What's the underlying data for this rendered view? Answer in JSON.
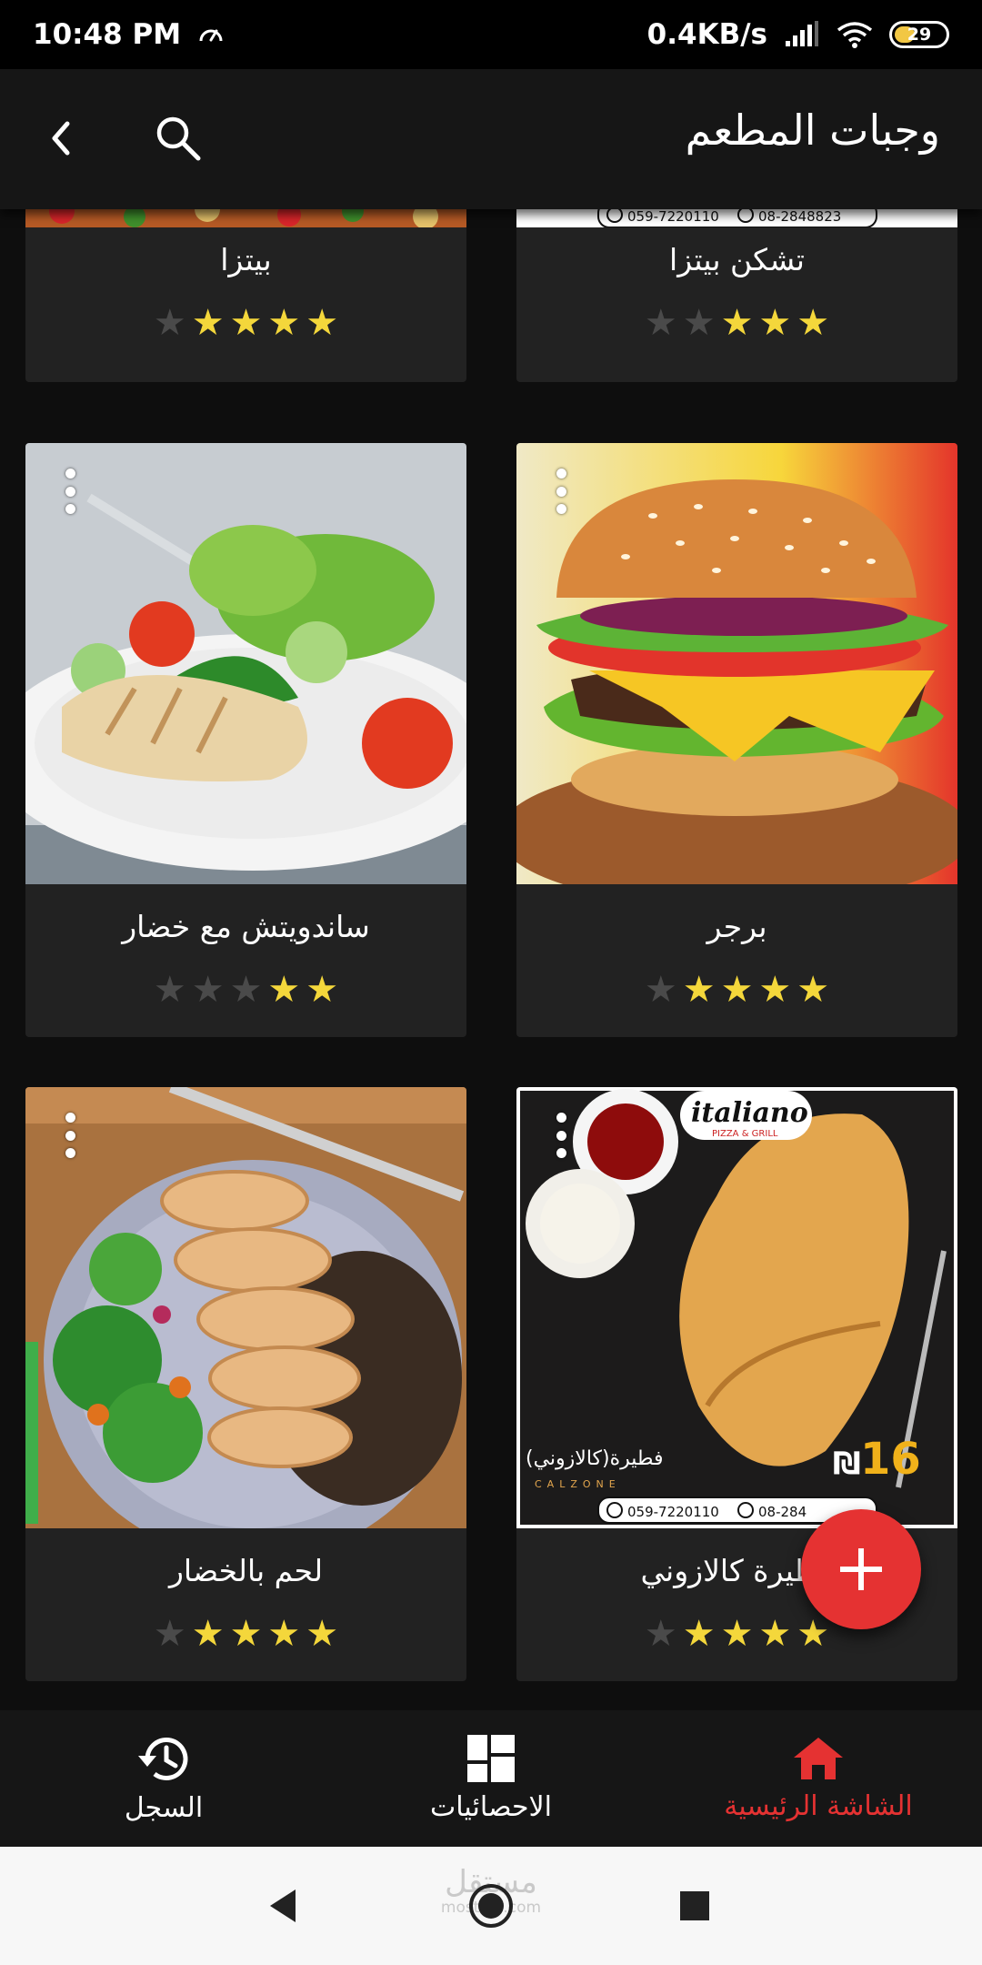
{
  "status_bar": {
    "time": "10:48 PM",
    "network_speed": "0.4KB/s",
    "battery_level": "29",
    "icons": [
      "speed-gauge-icon",
      "signal-icon",
      "wifi-icon",
      "battery-icon"
    ]
  },
  "app_bar": {
    "title": "وجبات المطعم",
    "back_icon": "chevron-left-icon",
    "search_icon": "search-icon"
  },
  "meals": [
    {
      "name": "تشكن بيتزا",
      "rating": 3,
      "max_rating": 5,
      "image": "pizza-photo-with-phone-banner"
    },
    {
      "name": "بيتزا",
      "rating": 4,
      "max_rating": 5,
      "image": "pizza-photo"
    },
    {
      "name": "برجر",
      "rating": 4,
      "max_rating": 5,
      "image": "burger-photo"
    },
    {
      "name": "ساندويتش مع خضار",
      "rating": 2,
      "max_rating": 5,
      "image": "grilled-chicken-salad-photo"
    },
    {
      "name": "فطيرة كالازوني",
      "rating": 4,
      "max_rating": 5,
      "image": "calzone-photo"
    },
    {
      "name": "لحم بالخضار",
      "rating": 4,
      "max_rating": 5,
      "image": "sliced-chicken-vegetables-photo"
    }
  ],
  "promo": {
    "brand": "italiano",
    "brand_sub": "PIZZA & GRILL",
    "item": "فطيرة(كالازوني)",
    "item_en": "CALZONE",
    "price": "16",
    "currency": "₪",
    "phone_mobile": "059-7220110",
    "phone_land": "08-2848823",
    "phone_land_cut": "08-284"
  },
  "fab": {
    "icon": "plus-icon"
  },
  "bottom_nav": {
    "items": [
      {
        "label": "الشاشة الرئيسية",
        "icon": "home-icon",
        "active": true
      },
      {
        "label": "الاحصائيات",
        "icon": "dashboard-icon",
        "active": false
      },
      {
        "label": "السجل",
        "icon": "history-icon",
        "active": false
      }
    ]
  },
  "system_nav": {
    "buttons": [
      "back-triangle-icon",
      "home-circle-icon",
      "recents-square-icon"
    ],
    "watermark_ar": "مستقل",
    "watermark_en": "mostaql.com"
  },
  "colors": {
    "accent": "#e53232",
    "star": "#f4d73b",
    "star_off": "#4a4a4a",
    "card": "#222222",
    "background": "#0e0e0e"
  }
}
